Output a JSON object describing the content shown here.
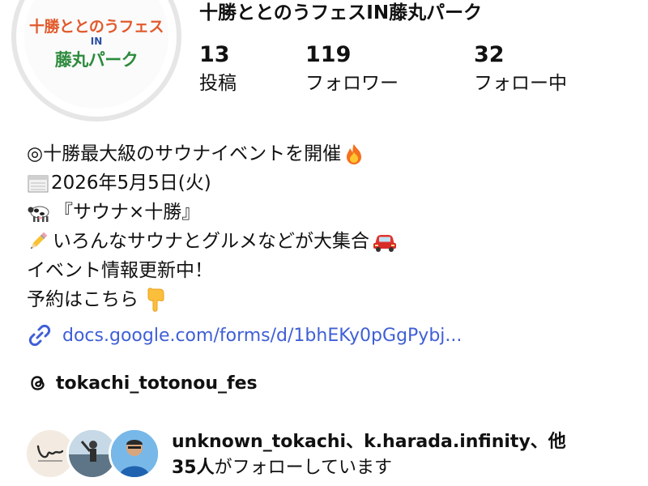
{
  "profile": {
    "name": "十勝ととのうフェスIN藤丸パーク",
    "avatar_logo": {
      "line1": "十勝ととのうフェス",
      "line2": "IN",
      "line3": "藤丸パーク"
    }
  },
  "stats": [
    {
      "value": "13",
      "label": "投稿"
    },
    {
      "value": "119",
      "label": "フォロワー"
    },
    {
      "value": "32",
      "label": "フォロー中"
    }
  ],
  "bio": {
    "line1": "◎十勝最大級のサウナイベントを開催",
    "line2": "2026年5月5日(火)",
    "line3": "『サウナ×十勝』",
    "line4": "いろんなサウナとグルメなどが大集合",
    "line5": "イベント情報更新中！",
    "line6": "予約はこちら"
  },
  "link": {
    "text": "docs.google.com/forms/d/1bhEKy0pGgPybj..."
  },
  "threads": {
    "handle": "tokachi_totonou_fes"
  },
  "followed_by": {
    "line1": "unknown_tokachi、k.harada.infinity、他",
    "count": "35人",
    "suffix": "がフォローしています"
  },
  "icons": [
    "fire-icon",
    "calendar-icon",
    "cow-icon",
    "pencil-icon",
    "car-icon",
    "pointing-down-icon",
    "link-icon",
    "threads-icon"
  ],
  "colors": {
    "link": "#3f5fd6",
    "logo_orange": "#e25a2c",
    "logo_green": "#2c8a3c",
    "logo_blue": "#2c4fa3"
  }
}
